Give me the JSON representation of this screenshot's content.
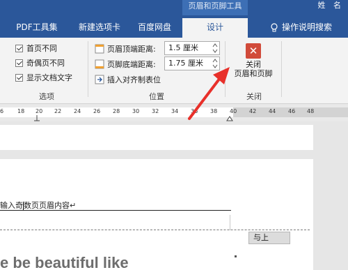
{
  "window": {
    "contextual_tab_title": "页眉和页脚工具",
    "user_name": "姓 名"
  },
  "tabs": [
    {
      "label": "PDF工具集"
    },
    {
      "label": "新建选项卡"
    },
    {
      "label": "百度网盘"
    },
    {
      "label": "设计",
      "active": true
    },
    {
      "label": "操作说明搜索"
    }
  ],
  "ribbon": {
    "options": {
      "items": [
        "首页不同",
        "奇偶页不同",
        "显示文档文字"
      ],
      "label": "选项"
    },
    "position": {
      "header_top_label": "页眉顶端距离:",
      "header_top_value": "1.5 厘米",
      "footer_bottom_label": "页脚底端距离:",
      "footer_bottom_value": "1.75 厘米",
      "insert_tab_label": "插入对齐制表位",
      "label": "位置"
    },
    "close": {
      "button_line1": "关闭",
      "button_line2": "页眉和页脚",
      "label": "关闭"
    }
  },
  "ruler": {
    "ticks": [
      "6",
      "18",
      "20",
      "22",
      "24",
      "26",
      "28",
      "30",
      "32",
      "34",
      "36",
      "38",
      "40",
      "42",
      "44",
      "46",
      "48"
    ]
  },
  "document": {
    "header_text_part1": "输入奇",
    "header_text_part2": "数页页眉内容↵",
    "previous_tag": "与上",
    "body_text": "e be beautiful like"
  },
  "colors": {
    "accent": "#2b579a",
    "close_red": "#d14b3a",
    "annotation_arrow": "#e8302a"
  }
}
